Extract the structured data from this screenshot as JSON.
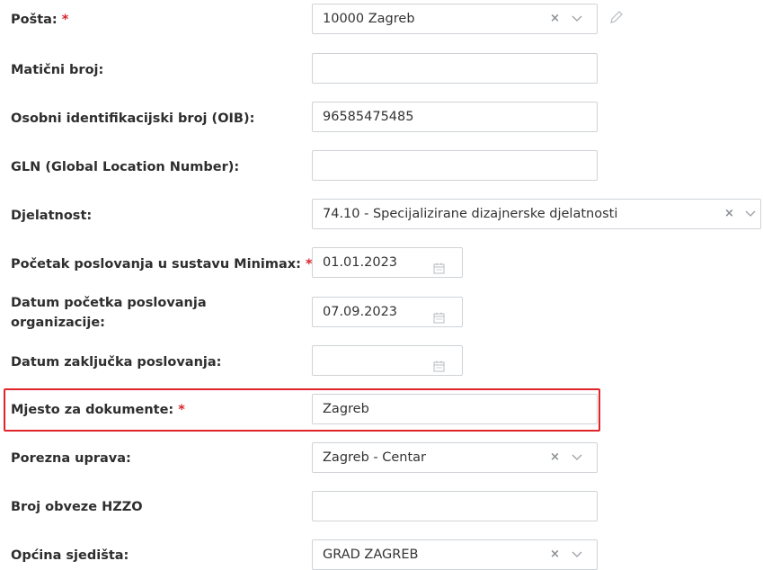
{
  "form": {
    "posta": {
      "label": "Pošta:",
      "required": "*",
      "value": "10000 Zagreb"
    },
    "maticni": {
      "label": "Matični broj:",
      "value": ""
    },
    "oib": {
      "label": "Osobni identifikacijski broj (OIB):",
      "value": "96585475485"
    },
    "gln": {
      "label": "GLN (Global Location Number):",
      "value": ""
    },
    "djelatnost": {
      "label": "Djelatnost:",
      "value": "74.10 - Specijalizirane dizajnerske djelatnosti"
    },
    "pocetak_minimax": {
      "label": "Početak poslovanja u sustavu Minimax:",
      "required": "*",
      "value": "01.01.2023"
    },
    "datum_pocetka": {
      "label_line1": "Datum početka poslovanja",
      "label_line2": "organizacije:",
      "value": "07.09.2023"
    },
    "datum_zakljucka": {
      "label": "Datum zaključka poslovanja:",
      "value": ""
    },
    "mjesto": {
      "label": "Mjesto za dokumente:",
      "required": "*",
      "value": "Zagreb"
    },
    "porezna": {
      "label": "Porezna uprava:",
      "value": "Zagreb - Centar"
    },
    "hzzo": {
      "label": "Broj obveze HZZO",
      "value": ""
    },
    "opcina": {
      "label": "Općina sjedišta:",
      "value": "GRAD ZAGREB"
    }
  },
  "icons": {
    "clear": "×",
    "chevron": "chevron-down-icon",
    "calendar": "calendar-icon",
    "pencil": "pencil-icon"
  },
  "colors": {
    "required": "#d9242c",
    "highlight": "#e0252a",
    "border": "#cfd3d7"
  }
}
